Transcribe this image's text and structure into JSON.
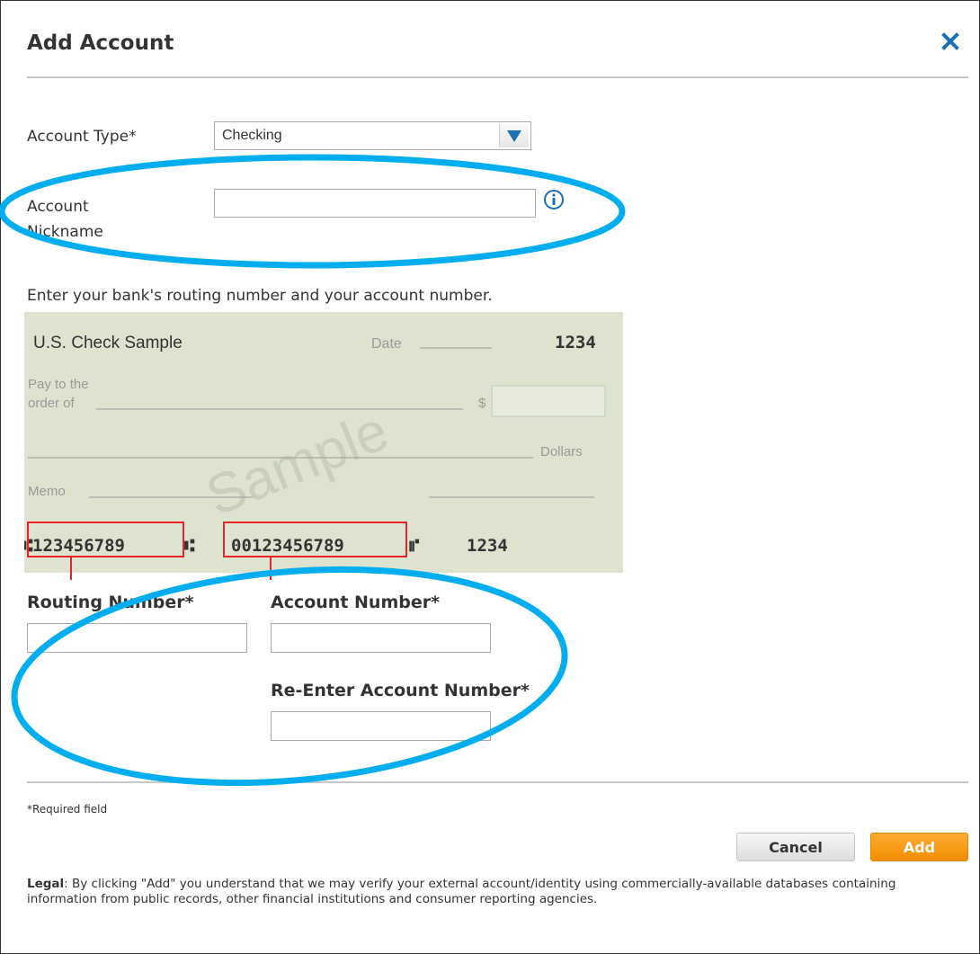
{
  "dialog": {
    "title": "Add Account",
    "close_icon": "close-icon"
  },
  "form": {
    "account_type_label": "Account Type*",
    "account_type_value": "Checking",
    "nickname_label_line1": "Account",
    "nickname_label_line2": "Nickname",
    "nickname_value": "",
    "info_icon": "info-icon",
    "instructions": "Enter your bank's routing number and your account number."
  },
  "check": {
    "heading": "U.S. Check Sample",
    "date_label": "Date",
    "check_number": "1234",
    "pay_to_line1": "Pay to the",
    "pay_to_line2": "order of",
    "dollar_sign": "$",
    "dollars_label": "Dollars",
    "memo_label": "Memo",
    "watermark": "Sample",
    "micr_routing": "123456789",
    "micr_routing_symbol": "⑆",
    "micr_account": "00123456789",
    "micr_account_symbol": "⑈",
    "micr_check_number": "1234"
  },
  "fields": {
    "routing_label": "Routing Number*",
    "routing_value": "",
    "account_label": "Account Number*",
    "account_value": "",
    "reenter_label": "Re-Enter Account Number*",
    "reenter_value": ""
  },
  "footer": {
    "required_note": "*Required field",
    "cancel_label": "Cancel",
    "add_label": "Add",
    "legal_label": "Legal",
    "legal_text": ": By clicking \"Add\" you understand that we may verify your external account/identity using commercially-available databases containing information from public records, other financial institutions and consumer reporting agencies."
  },
  "colors": {
    "accent_blue": "#1a6fb5",
    "annotation_cyan": "#00aeef",
    "add_orange": "#f5961f",
    "check_bg": "#dde3cf",
    "highlight_red": "#e8232a"
  }
}
